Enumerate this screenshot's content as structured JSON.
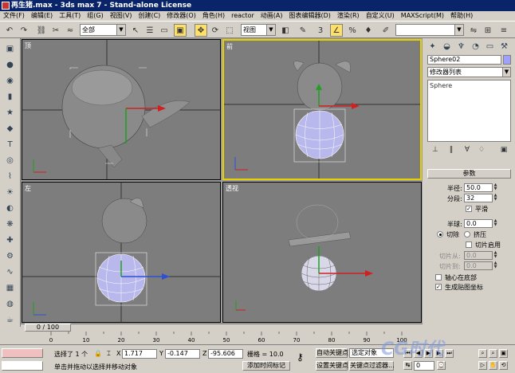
{
  "title": "再生猪.max - 3ds max 7 - Stand-alone License",
  "menu": [
    "文件(F)",
    "编辑(E)",
    "工具(T)",
    "组(G)",
    "视图(V)",
    "创建(C)",
    "修改器(O)",
    "角色(H)",
    "reactor",
    "动画(A)",
    "图表编辑器(D)",
    "渲染(R)",
    "自定义(U)",
    "MAXScript(M)",
    "帮助(H)"
  ],
  "toolbar": {
    "selection_filter": "全部",
    "ref_coord": "视图",
    "named_selection": ""
  },
  "viewports": {
    "top": "顶",
    "front": "前",
    "left": "左",
    "persp": "透视"
  },
  "command_panel": {
    "object_name": "Sphere02",
    "object_color": "#a0a0ff",
    "modifier_list": "修改器列表",
    "stack_item": "Sphere",
    "rollout_title": "参数",
    "radius_label": "半径:",
    "radius_value": "50.0",
    "segments_label": "分段:",
    "segments_value": "32",
    "smooth_label": "平滑",
    "hemisphere_label": "半球:",
    "hemisphere_value": "0.0",
    "chop_label": "切除",
    "squash_label": "挤压",
    "slice_on_label": "切片启用",
    "slice_from_label": "切片从:",
    "slice_from_value": "0.0",
    "slice_to_label": "切片到:",
    "slice_to_value": "0.0",
    "base_to_pivot_label": "轴心在底部",
    "gen_map_label": "生成贴图坐标"
  },
  "time": {
    "frame_display": "0 / 100",
    "ticks": [
      "0",
      "10",
      "20",
      "30",
      "40",
      "50",
      "60",
      "70",
      "80",
      "90",
      "100"
    ]
  },
  "status": {
    "selected": "选择了 1 个",
    "x_label": "X",
    "x_value": "1.717",
    "y_label": "Y",
    "y_value": "-0.147",
    "z_label": "Z",
    "z_value": "-95.606",
    "grid": "栅格 = 10.0",
    "prompt": "单击并拖动以选择并移动对象",
    "add_time_tag": "添加时间标记",
    "auto_key": "自动关键点",
    "set_key": "设置关键点",
    "selected_obj": "选定对象",
    "key_filters": "关键点过滤器...",
    "frame": "0"
  },
  "watermark": "CG时代"
}
